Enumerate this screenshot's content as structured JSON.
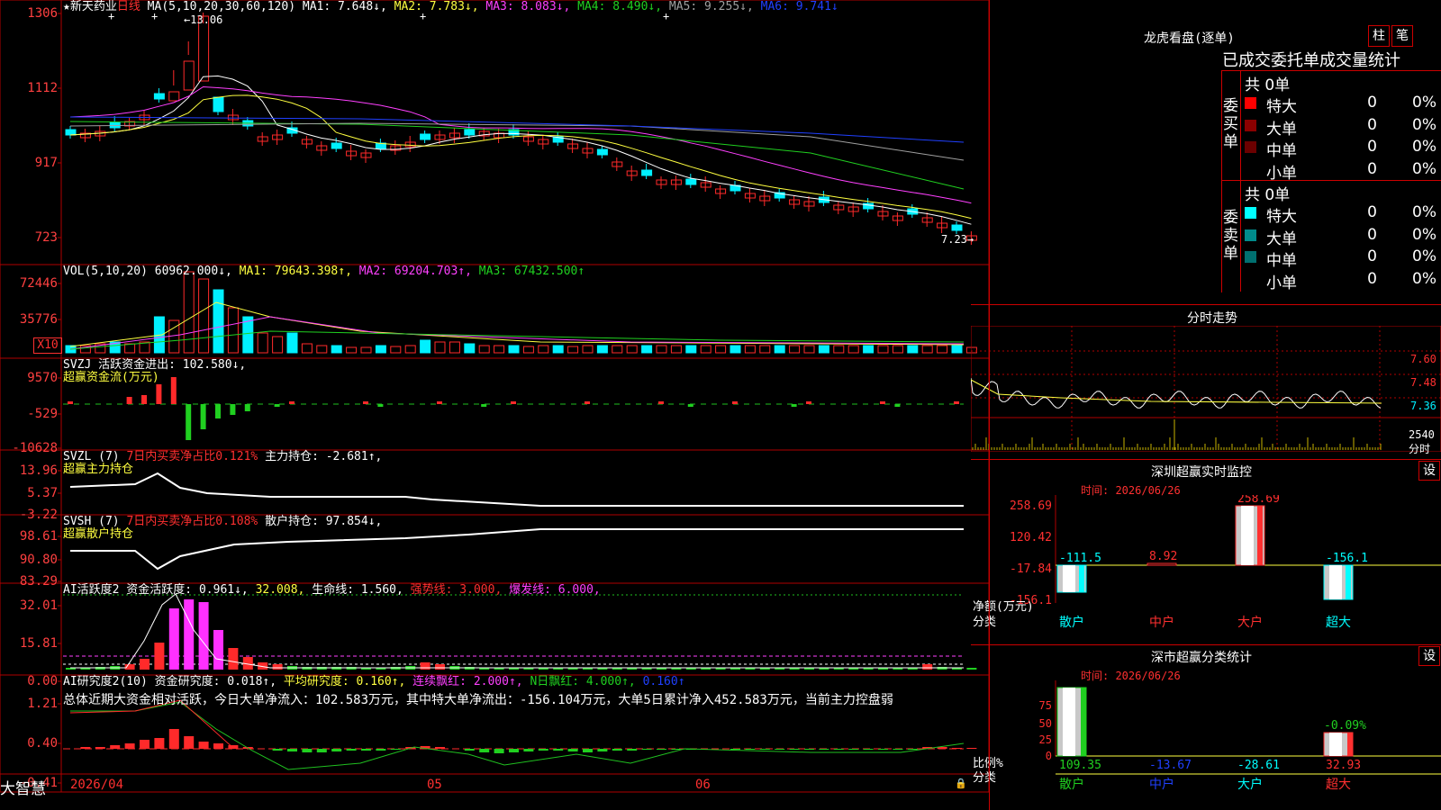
{
  "colors": {
    "up": "#ff2a2a",
    "down": "#00f0ff",
    "grid": "#b00000",
    "ma1": "#ffffff",
    "ma2": "#ffff40",
    "ma3": "#ff40ff",
    "ma4": "#20d020",
    "ma5": "#a0a0a0",
    "ma6": "#2040ff"
  },
  "price_panel": {
    "stock_name": "★新天药业",
    "period": "日线",
    "ma_header": "MA(5,10,20,30,60,120)",
    "ma_values": [
      {
        "label": "MA1: 7.648↓,",
        "color": "#ffffff"
      },
      {
        "label": "MA2: 7.783↓,",
        "color": "#ffff40"
      },
      {
        "label": "MA3: 8.083↓,",
        "color": "#ff40ff"
      },
      {
        "label": "MA4: 8.490↓,",
        "color": "#20d020"
      },
      {
        "label": "MA5: 9.255↓,",
        "color": "#a0a0a0"
      },
      {
        "label": "MA6: 9.741↓",
        "color": "#2040ff"
      }
    ],
    "y_ticks": [
      "1306",
      "1112",
      "917",
      "723"
    ],
    "high_marker": "13.06",
    "low_marker": "7.23"
  },
  "vol_panel": {
    "header": "VOL(5,10,20)",
    "values": [
      {
        "label": "60962.000↓,",
        "color": "#ffffff"
      },
      {
        "label": "MA1: 79643.398↑,",
        "color": "#ffff40"
      },
      {
        "label": "MA2: 69204.703↑,",
        "color": "#ff40ff"
      },
      {
        "label": "MA3: 67432.500↑",
        "color": "#20d020"
      }
    ],
    "y_ticks": [
      "72446",
      "35776"
    ],
    "unit": "X10"
  },
  "svzj_panel": {
    "header": "SVZJ  活跃资金进出: 102.580↓,",
    "subtitle": "超赢资金流(万元)",
    "y_ticks": [
      "9570",
      "-529",
      "-10628"
    ]
  },
  "svzl_panel": {
    "header_a": "SVZL (7)",
    "header_b": "7日内买卖净占比0.121%",
    "header_c": "主力持仓: -2.681↑,",
    "subtitle": "超赢主力持仓",
    "y_ticks": [
      "13.96",
      "5.37",
      "-3.22"
    ]
  },
  "svsh_panel": {
    "header_a": "SVSH (7)",
    "header_b": "7日内买卖净占比0.108%",
    "header_c": "散户持仓: 97.854↓,",
    "subtitle": "超赢散户持仓",
    "y_ticks": [
      "98.61",
      "90.80",
      "83.29"
    ]
  },
  "ai_active_panel": {
    "header_a": "AI活跃度2 资金活跃度: 0.961↓,",
    "header_b": "32.008,",
    "header_c": "生命线: 1.560,",
    "header_d": "强势线: 3.000,",
    "header_e": "爆发线: 6.000,",
    "y_ticks": [
      "32.01",
      "15.81",
      "0.00"
    ]
  },
  "ai_research_panel": {
    "header_a": "AI研究度2(10) 资金研究度: 0.018↑,",
    "header_b": "平均研究度: 0.160↑,",
    "header_c": "连续飘红: 2.000↑,",
    "header_d": "N日飘红: 4.000↑,",
    "header_e": "0.160↑",
    "summary": "总体近期大资金相对活跃，今日大单净流入：102.583万元，其中特大单净流出：-156.104万元，大单5日累计净入452.583万元，当前主力控盘弱",
    "y_ticks": [
      "1.21",
      "0.40",
      "-0.41"
    ]
  },
  "x_axis": {
    "labels": [
      "2026/04",
      "05",
      "06"
    ]
  },
  "brand": "大智慧",
  "right": {
    "lhkp": {
      "title": "龙虎看盘(逐单)",
      "btn1": "柱",
      "btn2": "笔",
      "subtitle": "已成交委托单成交量统计",
      "buy": {
        "side_label": "委买单",
        "total": "共 0单",
        "rows": [
          {
            "name": "特大",
            "count": "0",
            "pct": "0%",
            "color": "#ff0000"
          },
          {
            "name": "大单",
            "count": "0",
            "pct": "0%",
            "color": "#8b0000"
          },
          {
            "name": "中单",
            "count": "0",
            "pct": "0%",
            "color": "#6b0000"
          },
          {
            "name": "小单",
            "count": "0",
            "pct": "0%",
            "color": "#000000"
          }
        ]
      },
      "sell": {
        "side_label": "委卖单",
        "total": "共 0单",
        "rows": [
          {
            "name": "特大",
            "count": "0",
            "pct": "0%",
            "color": "#00ffff"
          },
          {
            "name": "大单",
            "count": "0",
            "pct": "0%",
            "color": "#008b8b"
          },
          {
            "name": "中单",
            "count": "0",
            "pct": "0%",
            "color": "#007070"
          },
          {
            "name": "小单",
            "count": "0",
            "pct": "0%",
            "color": "#000000"
          }
        ]
      }
    },
    "fenshi": {
      "title": "分时走势",
      "y_ticks": [
        "7.60",
        "7.48",
        "7.36"
      ],
      "vol_tick": "2540",
      "vol_unit": "分时"
    },
    "monitor": {
      "title": "深圳超赢实时监控",
      "btn": "设",
      "time": "时间: 2026/06/26",
      "y_ticks": [
        "258.69",
        "120.42",
        "-17.84",
        "-156.1"
      ],
      "bar_labels": [
        "-111.5",
        "8.92",
        "258.69",
        "-156.1"
      ],
      "categories": [
        "散户",
        "中户",
        "大户",
        "超大"
      ],
      "axis_label": "净额(万元)",
      "axis_label2": "分类"
    },
    "stats": {
      "title": "深市超赢分类统计",
      "btn": "设",
      "time": "时间: 2026/06/26",
      "y_ticks": [
        "75",
        "50",
        "25",
        "0"
      ],
      "bar_top_label": "-0.09%",
      "values": [
        "109.35",
        "-13.67",
        "-28.61",
        "32.93"
      ],
      "categories": [
        "散户",
        "中户",
        "大户",
        "超大"
      ],
      "axis_label": "比例%",
      "axis_label2": "分类"
    }
  }
}
